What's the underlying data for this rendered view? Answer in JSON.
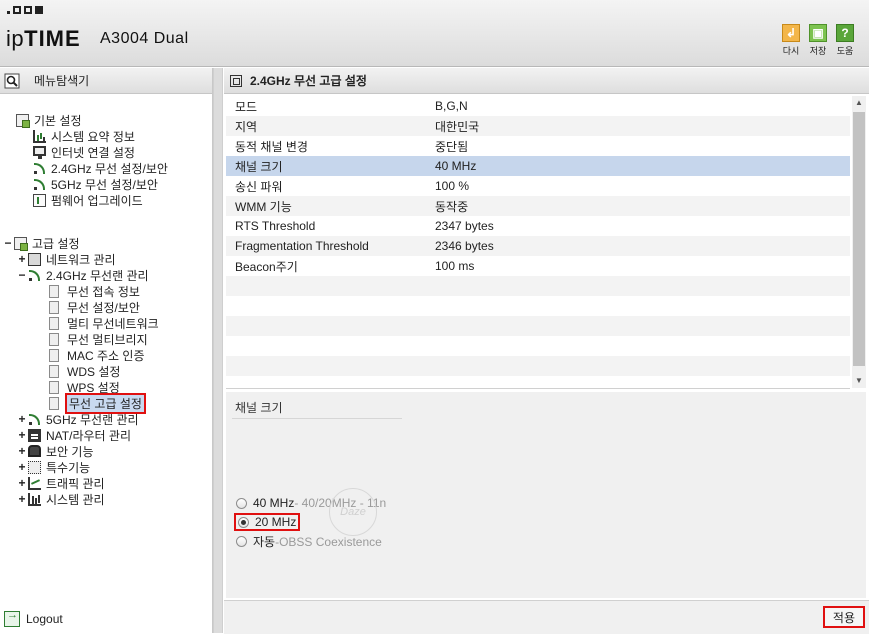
{
  "header": {
    "brand_ip": "ip",
    "brand_time": "TIME",
    "model": "A3004 Dual",
    "toolbar": [
      {
        "label": "다시",
        "icon": "back-icon"
      },
      {
        "label": "저장",
        "icon": "save-icon"
      },
      {
        "label": "도움",
        "icon": "help-icon"
      }
    ]
  },
  "sidebar": {
    "title": "메뉴탐색기",
    "basic": {
      "label": "기본 설정",
      "items": [
        {
          "label": "시스템 요약 정보",
          "icon": "chart-icon"
        },
        {
          "label": "인터넷 연결 설정",
          "icon": "monitor-icon"
        },
        {
          "label": "2.4GHz 무선 설정/보안",
          "icon": "wifi-icon"
        },
        {
          "label": "5GHz 무선 설정/보안",
          "icon": "wifi-icon"
        },
        {
          "label": "펌웨어 업그레이드",
          "icon": "firmware-icon"
        }
      ]
    },
    "advanced": {
      "label": "고급 설정",
      "network": "네트워크 관리",
      "wireless24": "2.4GHz 무선랜 관리",
      "wireless24_items": [
        "무선 접속 정보",
        "무선 설정/보안",
        "멀티 무선네트워크",
        "무선 멀티브리지",
        "MAC 주소 인증",
        "WDS 설정",
        "WPS 설정",
        "무선 고급 설정"
      ],
      "rest": [
        {
          "label": "5GHz 무선랜 관리",
          "icon": "wifi-icon"
        },
        {
          "label": "NAT/라우터 관리",
          "icon": "nat-icon"
        },
        {
          "label": "보안 기능",
          "icon": "lock-icon"
        },
        {
          "label": "특수기능",
          "icon": "special-icon"
        },
        {
          "label": "트래픽 관리",
          "icon": "traffic-icon"
        },
        {
          "label": "시스템 관리",
          "icon": "system-icon"
        }
      ]
    },
    "logout": "Logout"
  },
  "main": {
    "title": "2.4GHz 무선 고급 설정",
    "rows": [
      {
        "key": "모드",
        "value": "B,G,N"
      },
      {
        "key": "지역",
        "value": "대한민국"
      },
      {
        "key": "동적 채널 변경",
        "value": "중단됨"
      },
      {
        "key": "채널 크기",
        "value": "40 MHz"
      },
      {
        "key": "송신 파워",
        "value": "100 %"
      },
      {
        "key": "WMM 기능",
        "value": "동작중"
      },
      {
        "key": "RTS Threshold",
        "value": "2347 bytes"
      },
      {
        "key": "Fragmentation Threshold",
        "value": "2346 bytes"
      },
      {
        "key": "Beacon주기",
        "value": "100 ms"
      }
    ],
    "detail": {
      "title": "채널 크기",
      "opt40": "40 MHz",
      "opt40_note": " - 40/20MHz - 11n",
      "opt20": "20 MHz",
      "opt_auto": "자동",
      "opt_auto_note": " -OBSS Coexistence",
      "selected": "20 MHz"
    },
    "watermark": "Daze",
    "apply_label": "적용"
  }
}
